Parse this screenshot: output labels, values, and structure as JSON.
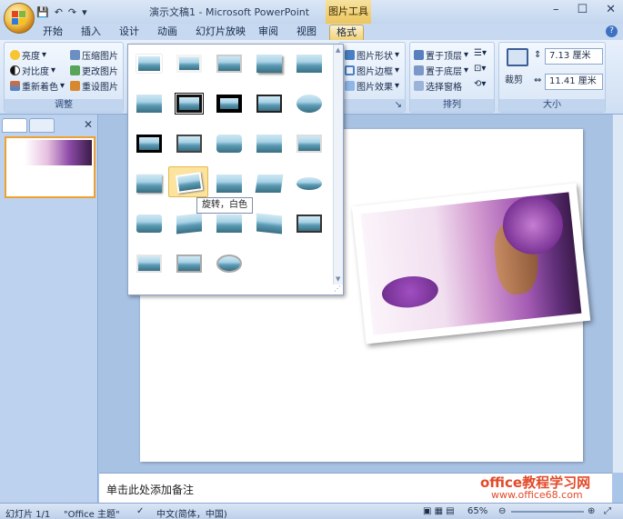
{
  "window": {
    "title": "演示文稿1 - Microsoft PowerPoint",
    "context_tab_title": "图片工具",
    "controls": [
      "–",
      "☐",
      "✕"
    ]
  },
  "qat": [
    "💾",
    "↶",
    "↷",
    "▾"
  ],
  "tabs": [
    "开始",
    "插入",
    "设计",
    "动画",
    "幻灯片放映",
    "审阅",
    "视图",
    "格式"
  ],
  "ribbon": {
    "adjust": {
      "label": "调整",
      "brightness": "亮度",
      "contrast": "对比度",
      "recolor": "重新着色",
      "compress": "压缩图片",
      "change": "更改图片",
      "reset": "重设图片"
    },
    "picture_style": {
      "shape": "图片形状",
      "border": "图片边框",
      "effects": "图片效果"
    },
    "arrange": {
      "label": "排列",
      "front": "置于顶层",
      "back": "置于底层",
      "selection": "选择窗格"
    },
    "size": {
      "label": "大小",
      "crop": "裁剪",
      "height": "7.13 厘米",
      "width": "11.41 厘米"
    }
  },
  "gallery": {
    "tooltip": "旋转，白色"
  },
  "slide_panel": {
    "number": "1"
  },
  "notes": {
    "placeholder": "单击此处添加备注"
  },
  "watermark": {
    "line1": "office教程学习网",
    "line2": "www.office68.com"
  },
  "statusbar": {
    "slide": "幻灯片 1/1",
    "theme": "\"Office 主题\"",
    "language": "中文(简体，中国)",
    "zoom": "65%"
  },
  "colors": {
    "accent": "#f2d27a",
    "ribbon": "#cfdff3",
    "frame": "#3d72c2"
  }
}
